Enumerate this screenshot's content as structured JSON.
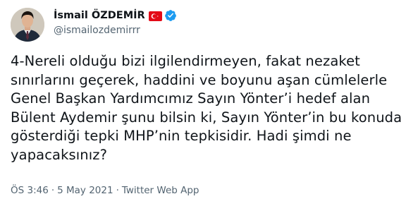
{
  "tweet": {
    "display_name": "İsmail ÖZDEMİR",
    "handle": "@ismailozdemirrr",
    "verified_icon": "verified-badge-icon",
    "flag_icon": "turkey-flag-icon",
    "text": "4-Nereli olduğu bizi ilgilendirmeyen, fakat nezaket sınırlarını geçerek, haddini ve boyunu aşan cümlelerle Genel Başkan Yardımcımız Sayın Yönter’i hedef alan Bülent Aydemir şunu bilsin ki, Sayın Yönter’in bu konuda gösterdiği tepki MHP’nin tepkisidir. Hadi şimdi ne yapacaksınız?",
    "time": "ÖS 3:46",
    "date": "5 May 2021",
    "separator": "·",
    "source": "Twitter Web App"
  },
  "colors": {
    "text_primary": "#0f1419",
    "text_secondary": "#536471",
    "verified_blue": "#1d9bf0",
    "flag_red": "#e30a17"
  }
}
